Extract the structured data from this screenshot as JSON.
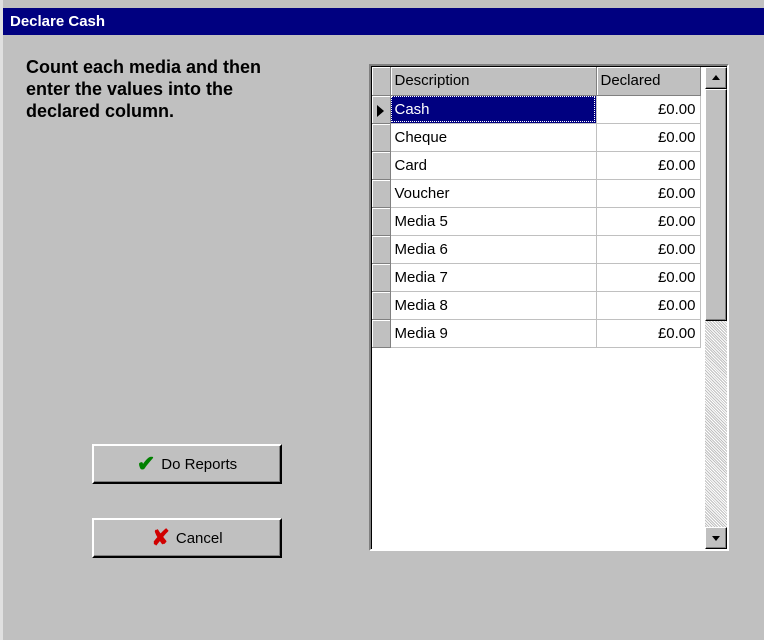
{
  "window": {
    "title": "Declare Cash"
  },
  "instructions": "Count each media and then\nenter the values into  the\ndeclared column.",
  "buttons": {
    "do_reports": {
      "label": "Do Reports",
      "icon": "check-icon"
    },
    "cancel": {
      "label": "Cancel",
      "icon": "cross-icon"
    }
  },
  "grid": {
    "columns": [
      "Description",
      "Declared"
    ],
    "rows": [
      {
        "description": "Cash",
        "declared": "£0.00"
      },
      {
        "description": "Cheque",
        "declared": "£0.00"
      },
      {
        "description": "Card",
        "declared": "£0.00"
      },
      {
        "description": "Voucher",
        "declared": "£0.00"
      },
      {
        "description": "Media 5",
        "declared": "£0.00"
      },
      {
        "description": "Media 6",
        "declared": "£0.00"
      },
      {
        "description": "Media 7",
        "declared": "£0.00"
      },
      {
        "description": "Media 8",
        "declared": "£0.00"
      },
      {
        "description": "Media 9",
        "declared": "£0.00"
      }
    ]
  },
  "colors": {
    "title_bar": "#000080",
    "face": "#c0c0c0",
    "selection": "#000080"
  }
}
